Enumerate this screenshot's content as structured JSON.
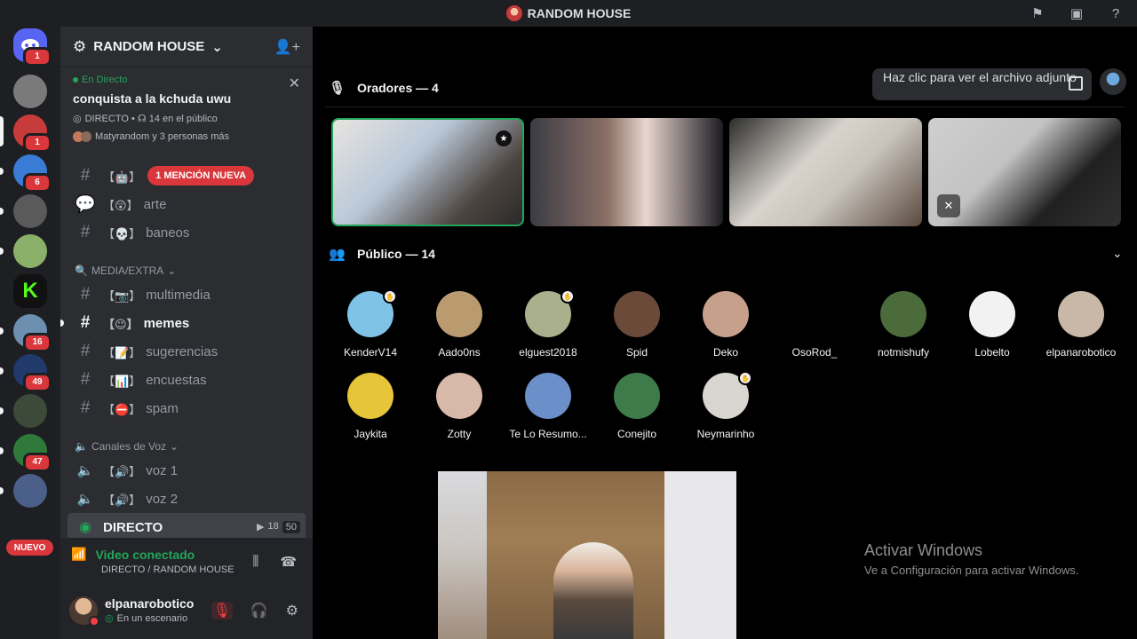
{
  "window": {
    "title": "RANDOM HOUSE"
  },
  "guild_badges": [
    "1",
    "1",
    "6",
    "16",
    "49",
    "47"
  ],
  "new_badge": "NUEVO",
  "server": {
    "name": "RANDOM HOUSE"
  },
  "live": {
    "tag": "En Directo",
    "title": "conquista a la kchuda uwu",
    "meta": "DIRECTO • ☊ 14 en el público",
    "who": "Matyrandom y 3 personas más"
  },
  "channels": {
    "c1": {
      "emoji": "【🤖】",
      "mention": "1 MENCIÓN NUEVA"
    },
    "c2": {
      "emoji": "【😲】",
      "label": "arte"
    },
    "c3": {
      "emoji": "【💀】",
      "label": "baneos"
    },
    "cat1": "MEDIA/EXTRA",
    "c4": {
      "emoji": "【📷】",
      "label": "multimedia"
    },
    "c5": {
      "emoji": "【😉】",
      "label": "memes"
    },
    "c6": {
      "emoji": "【📝】",
      "label": "sugerencias"
    },
    "c7": {
      "emoji": "【📊】",
      "label": "encuestas"
    },
    "c8": {
      "emoji": "【⛔】",
      "label": "spam"
    },
    "cat2": "Canales de Voz",
    "v1": {
      "emoji": "【🔊】",
      "label": "voz 1"
    },
    "v2": {
      "emoji": "【🔊】",
      "label": "voz 2"
    },
    "stage": {
      "label": "DIRECTO",
      "count": "18",
      "limit": "50"
    }
  },
  "voice": {
    "state": "Video conectado",
    "sub": "DIRECTO / RANDOM HOUSE"
  },
  "user": {
    "name": "elpanarobotico",
    "status": "En un escenario"
  },
  "speakers": {
    "header": "Oradores — 4"
  },
  "attachment": {
    "text": "Haz clic para ver el archivo adjunto"
  },
  "audience": {
    "header": "Público — 14",
    "members": [
      "KenderV14",
      "Aado0ns",
      "elguest2018",
      "Spid",
      "Deko",
      "OsoRod_",
      "notmishufy",
      "Lobelto",
      "elpanarobotico",
      "Jaykita",
      "Zotty",
      "Te Lo Resumo...",
      "Conejito",
      "Neymarinho"
    ]
  },
  "watermark": {
    "line1": "Activar Windows",
    "line2": "Ve a Configuración para activar Windows."
  },
  "colors": {
    "accent_green": "#23a55a",
    "mention_red": "#da373c",
    "sidebar": "#2b2d31"
  }
}
